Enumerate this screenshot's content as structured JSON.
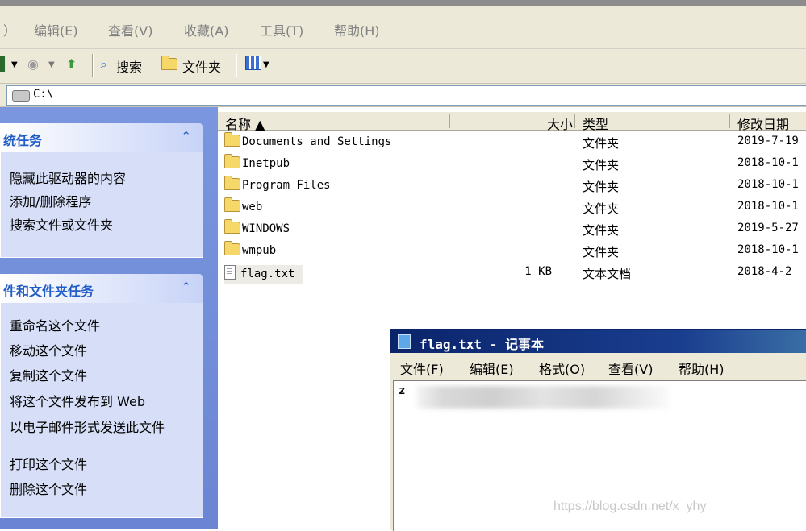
{
  "menubar": {
    "items": [
      "）",
      "编辑(E)",
      "查看(V)",
      "收藏(A)",
      "工具(T)",
      "帮助(H)"
    ]
  },
  "toolbar": {
    "search_label": "搜索",
    "folders_label": "文件夹"
  },
  "address": {
    "path": "C:\\"
  },
  "left_pane": {
    "system_tasks": {
      "title": "统任务",
      "links": [
        "隐藏此驱动器的内容",
        "添加/删除程序",
        "搜索文件或文件夹"
      ]
    },
    "file_tasks": {
      "title": "件和文件夹任务",
      "links": [
        "重命名这个文件",
        "移动这个文件",
        "复制这个文件",
        "将这个文件发布到 Web",
        "以电子邮件形式发送此文件",
        "打印这个文件",
        "删除这个文件"
      ]
    }
  },
  "file_list": {
    "headers": {
      "name": "名称 ▲",
      "size": "大小",
      "type": "类型",
      "modified": "修改日期"
    },
    "rows": [
      {
        "name": "Documents and Settings",
        "size": "",
        "type": "文件夹",
        "modified": "2019-7-19"
      },
      {
        "name": "Inetpub",
        "size": "",
        "type": "文件夹",
        "modified": "2018-10-1"
      },
      {
        "name": "Program Files",
        "size": "",
        "type": "文件夹",
        "modified": "2018-10-1"
      },
      {
        "name": "web",
        "size": "",
        "type": "文件夹",
        "modified": "2018-10-1"
      },
      {
        "name": "WINDOWS",
        "size": "",
        "type": "文件夹",
        "modified": "2019-5-27"
      },
      {
        "name": "wmpub",
        "size": "",
        "type": "文件夹",
        "modified": "2018-10-1"
      },
      {
        "name": "flag.txt",
        "size": "1 KB",
        "type": "文本文档",
        "modified": "2018-4-2"
      }
    ]
  },
  "notepad": {
    "title": "flag.txt - 记事本",
    "menu": [
      "文件(F)",
      "编辑(E)",
      "格式(O)",
      "查看(V)",
      "帮助(H)"
    ],
    "content": "z"
  },
  "watermark": "https://blog.csdn.net/x_yhy"
}
